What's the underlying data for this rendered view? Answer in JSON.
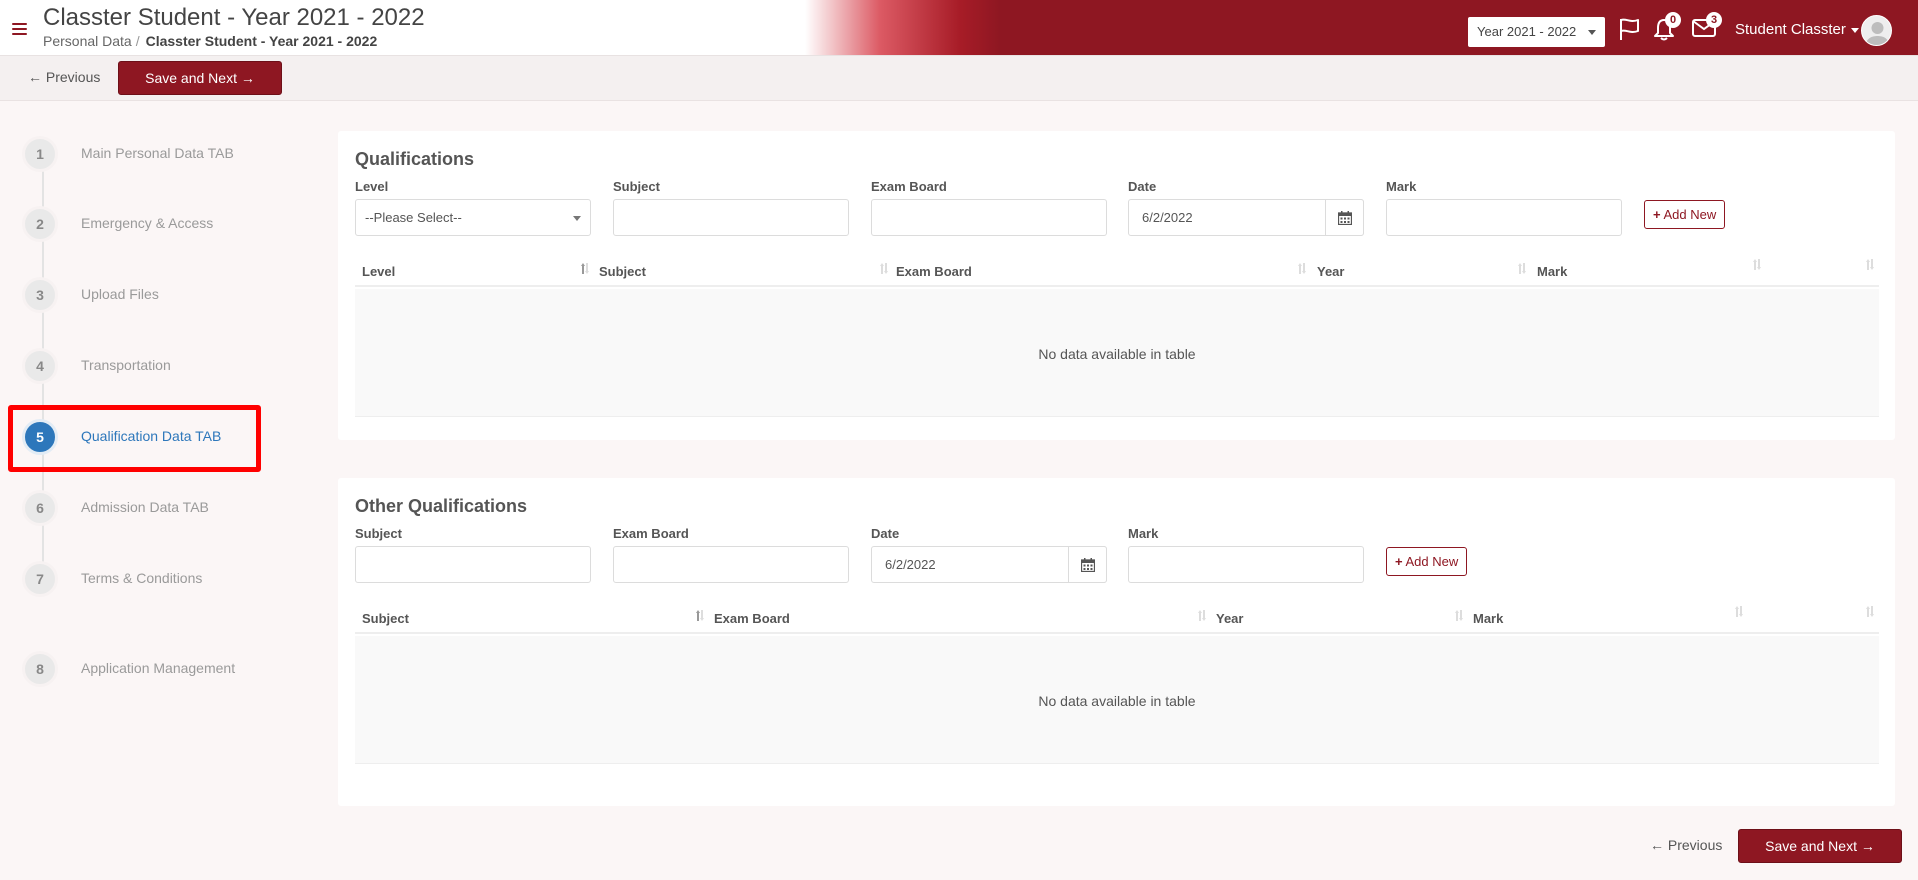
{
  "header": {
    "title": "Classter Student - Year 2021 - 2022",
    "breadcrumb": [
      "Personal Data",
      "Classter Student - Year 2021 - 2022"
    ],
    "year_select": "Year 2021 - 2022",
    "notifications_count": "0",
    "messages_count": "3",
    "user_name": "Student Classter"
  },
  "toolbar": {
    "previous_label": "← Previous",
    "save_next_label": "Save and Next →"
  },
  "steps": [
    {
      "number": "1",
      "label": "Main Personal Data TAB"
    },
    {
      "number": "2",
      "label": "Emergency & Access"
    },
    {
      "number": "3",
      "label": "Upload Files"
    },
    {
      "number": "4",
      "label": "Transportation"
    },
    {
      "number": "5",
      "label": "Qualification Data TAB"
    },
    {
      "number": "6",
      "label": "Admission Data TAB"
    },
    {
      "number": "7",
      "label": "Terms & Conditions"
    },
    {
      "number": "8",
      "label": "Application Management"
    }
  ],
  "qualifications": {
    "title": "Qualifications",
    "labels": {
      "level": "Level",
      "subject": "Subject",
      "exam_board": "Exam Board",
      "date": "Date",
      "mark": "Mark"
    },
    "level_select": "--Please Select--",
    "date_value": "6/2/2022",
    "add_label": "Add New",
    "columns": [
      "Level",
      "Subject",
      "Exam Board",
      "Year",
      "Mark"
    ],
    "empty_message": "No data available in table"
  },
  "other_qualifications": {
    "title": "Other Qualifications",
    "labels": {
      "subject": "Subject",
      "exam_board": "Exam Board",
      "date": "Date",
      "mark": "Mark"
    },
    "date_value": "6/2/2022",
    "add_label": "Add New",
    "columns": [
      "Subject",
      "Exam Board",
      "Year",
      "Mark"
    ],
    "empty_message": "No data available in table"
  },
  "footer": {
    "previous_label": "← Previous",
    "save_next_label": "Save and Next →"
  },
  "colors": {
    "brand": "#8e1722",
    "active_step": "#2d77bb",
    "highlight": "#ff0000"
  }
}
